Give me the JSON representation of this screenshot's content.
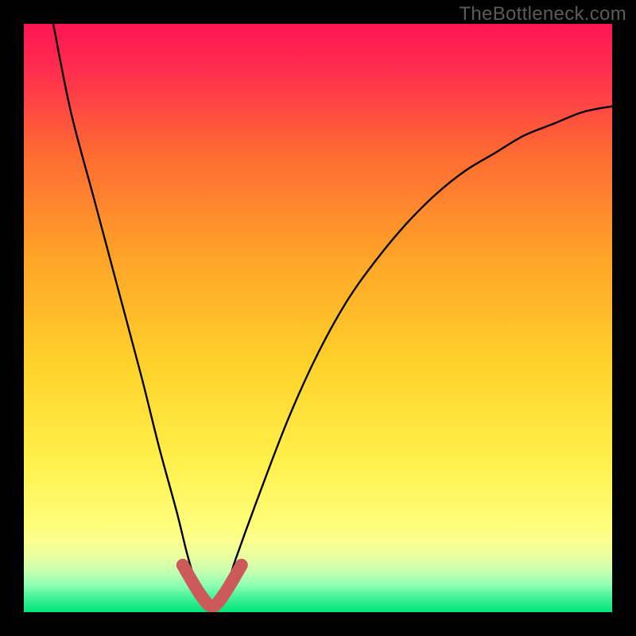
{
  "watermark": "TheBottleneck.com",
  "colors": {
    "black": "#000000",
    "grad_top": "#ff1553",
    "grad_mid_upper": "#ff7a2b",
    "grad_mid": "#ffd22a",
    "grad_lower": "#fff86a",
    "grad_bottom_band1": "#c8ff7a",
    "grad_bottom_band2": "#00e676",
    "curve": "#000000",
    "valley_stroke": "#cc5a5a"
  },
  "chart_data": {
    "type": "line",
    "title": "",
    "xlabel": "",
    "ylabel": "",
    "xlim": [
      0,
      100
    ],
    "ylim": [
      0,
      100
    ],
    "series": [
      {
        "name": "bottleneck-curve",
        "x": [
          5,
          8,
          12,
          16,
          20,
          23,
          26,
          28,
          30,
          32,
          34,
          36,
          40,
          45,
          50,
          55,
          60,
          65,
          70,
          75,
          80,
          85,
          90,
          95,
          100
        ],
        "y": [
          100,
          85,
          70,
          55,
          40,
          28,
          17,
          9,
          3,
          1,
          3,
          9,
          20,
          33,
          44,
          53,
          60,
          66,
          71,
          75,
          78,
          81,
          83,
          85,
          86
        ]
      }
    ],
    "valley_region": {
      "x_start": 27,
      "x_end": 37,
      "y_max": 8
    },
    "annotations": []
  }
}
